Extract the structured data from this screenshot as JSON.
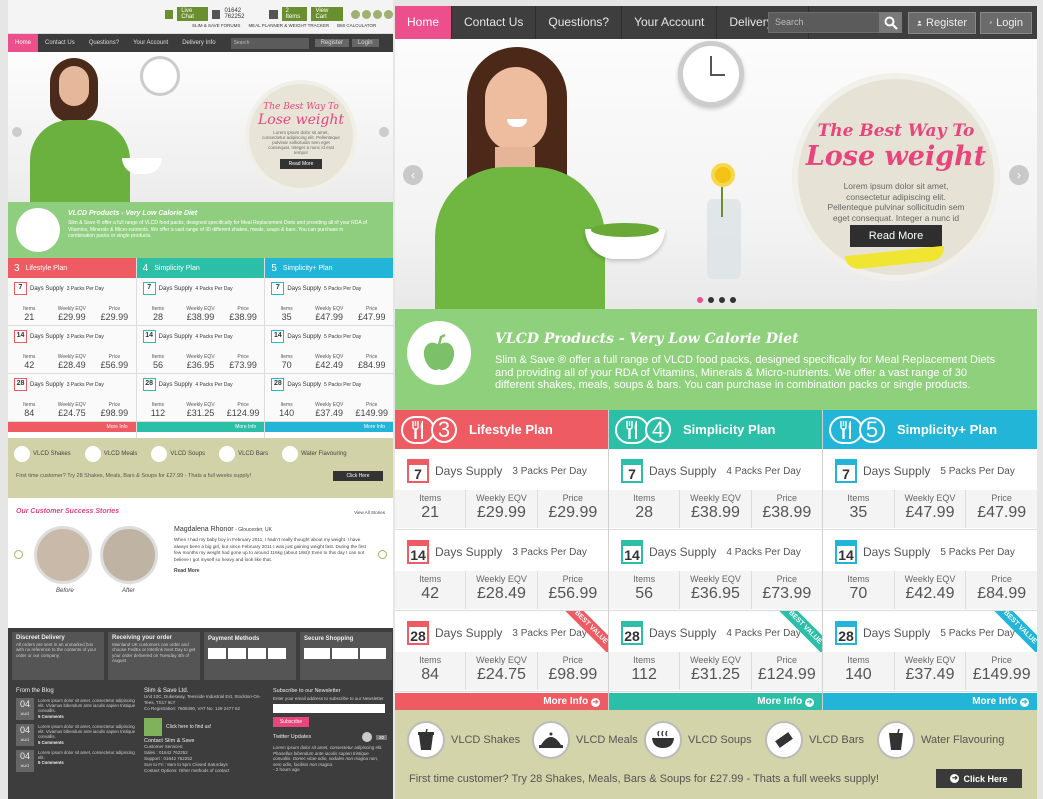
{
  "top_bar": {
    "live_chat": "Live Chat",
    "phone": "01642 762252",
    "items_count": "2 Items",
    "view_cart": "View Cart",
    "links": [
      "SLIM & SAVE FORUMS",
      "MEAL PLANNER & WEIGHT TRACKER",
      "BMI CALCULATOR"
    ]
  },
  "nav": {
    "items": [
      "Home",
      "Contact Us",
      "Questions?",
      "Your Account",
      "Delivery Info"
    ],
    "search_placeholder": "Search",
    "register": "Register",
    "login": "Login"
  },
  "hero": {
    "line1": "The Best Way To",
    "line2": "Lose weight",
    "body": "Lorem ipsum dolor sit amet, consectetur adipiscing elit. Pellenteque pulvinar sollicitudin sem eget consequat. Integer a nunc id erat tempor",
    "cta": "Read More"
  },
  "vlcd": {
    "title": "VLCD Products - Very Low Calorie Diet",
    "body": "Slim & Save ® offer a full range of VLCD food packs, designed specifically for Meal Replacement Diets and providing all of your RDA of Vitamins, Minerals & Micro-nutrients. We offer a vast range of 30 different shakes, meals, soups & bars. You can purchase in combination packs or single products."
  },
  "plans": [
    {
      "num": "3",
      "name": "Lifestyle Plan",
      "color": "#ef5b62",
      "rows": [
        {
          "days": "7",
          "label": "Days Supply",
          "packs": "3 Packs Per Day",
          "items": "21",
          "weekly": "£29.99",
          "price": "£29.99"
        },
        {
          "days": "14",
          "label": "Days Supply",
          "packs": "3 Packs Per Day",
          "items": "42",
          "weekly": "£28.49",
          "price": "£56.99"
        },
        {
          "days": "28",
          "label": "Days Supply",
          "packs": "3 Packs Per Day",
          "items": "84",
          "weekly": "£24.75",
          "price": "£98.99",
          "best": "BEST VALUE"
        }
      ],
      "more": "More Info"
    },
    {
      "num": "4",
      "name": "Simplicity Plan",
      "color": "#2cbfa8",
      "rows": [
        {
          "days": "7",
          "label": "Days Supply",
          "packs": "4 Packs Per Day",
          "items": "28",
          "weekly": "£38.99",
          "price": "£38.99"
        },
        {
          "days": "14",
          "label": "Days Supply",
          "packs": "4 Packs Per Day",
          "items": "56",
          "weekly": "£36.95",
          "price": "£73.99"
        },
        {
          "days": "28",
          "label": "Days Supply",
          "packs": "4 Packs Per Day",
          "items": "112",
          "weekly": "£31.25",
          "price": "£124.99",
          "best": "BEST VALUE"
        }
      ],
      "more": "More Info"
    },
    {
      "num": "5",
      "name": "Simplicity+ Plan",
      "color": "#22b5d7",
      "rows": [
        {
          "days": "7",
          "label": "Days Supply",
          "packs": "5 Packs Per Day",
          "items": "35",
          "weekly": "£47.99",
          "price": "£47.99"
        },
        {
          "days": "14",
          "label": "Days Supply",
          "packs": "5 Packs Per Day",
          "items": "70",
          "weekly": "£42.49",
          "price": "£84.99"
        },
        {
          "days": "28",
          "label": "Days Supply",
          "packs": "5 Packs Per Day",
          "items": "140",
          "weekly": "£37.49",
          "price": "£149.99",
          "best": "BEST VALUE"
        }
      ],
      "more": "More Info"
    }
  ],
  "col_labels": {
    "items": "Items",
    "weekly": "Weekly EQV",
    "price": "Price"
  },
  "categories": [
    "VLCD Shakes",
    "VLCD Meals",
    "VLCD Soups",
    "VLCD Bars",
    "Water Flavouring"
  ],
  "promo": {
    "text": "First time customer? Try 28 Shakes, Meals, Bars & Soups for £27.99  - Thats a full weeks supply!",
    "cta": "Click Here"
  },
  "stories": {
    "title": "Our Customer Success Stories",
    "view_all": "View All Stories",
    "name": "Magdalena Rhonor",
    "location": "- Gloucester, UK",
    "body": "When I had my baby boy in February 2011, I hadn't really thought about my weight. I have always been a big girl, but since February 2011 I was just gaining weight fast. During the first few months my weight had gone up to around 116kg (about 18st)! Even to this day I can not believe I got myself so heavy and look like that.",
    "read_more": "Read More",
    "before": "Before",
    "after": "After"
  },
  "footer": {
    "boxes": [
      {
        "title": "Discreet Delivery",
        "text": "All orders are sent in an unmarked box with no reference to the contents of your order or our company."
      },
      {
        "title": "Receiving your order",
        "text": "Mainland UK customers can order and choose FedEx or Interlink Next Day to get your order delivered on Tuesday 4th of August"
      },
      {
        "title": "Payment Methods"
      },
      {
        "title": "Secure Shopping"
      }
    ],
    "blog_title": "From the Blog",
    "blog": [
      {
        "day": "04",
        "mon": "AUG",
        "text": "Lorem ipsum dolor sit amet, consectetur adipiscing elit. Vivamus bibendum ante iaculis sapien tristique convallis.",
        "comments": "5 Comments"
      },
      {
        "day": "04",
        "mon": "AUG",
        "text": "Lorem ipsum dolor sit amet, consectetur adipiscing elit. Vivamus bibendum ante iaculis sapien tristique convallis.",
        "comments": "5 Comments"
      },
      {
        "day": "04",
        "mon": "AUG",
        "text": "Lorem ipsum dolor sit amet, consectetur adipiscing elit.",
        "comments": "5 Comments"
      }
    ],
    "company": "Slim & Save Ltd.",
    "address": "Unit 10C, Dukesway, Teesside Industrial Est, Stockton-On-Tees, TS17 9LT",
    "registration": "Co Registration: 7608490, VAT No. 129 2477 62",
    "map_link": "Click here to find us!",
    "contact_title": "Contact Slim & Save",
    "contact_lines": [
      "Customer Services:",
      "Sales : 01642 762252",
      "Support : 01642 762252",
      "Sun to Fri : 8am to 5pm Closed Saturdays"
    ],
    "contact_options": "Contact Options: Other methods of contact",
    "newsletter_title": "Subscribe to our Newsletter",
    "newsletter_hint": "Enter your email address to subscribe to our Newsletter",
    "subscribe": "Subscribe",
    "twitter_title": "Twitter Updates",
    "twitter_count": "20",
    "tweet": "Lorem ipsum dolor sit amet, consectetur adipiscing elit. Phasellus bibendum ante iaculis sapien tristique convallis. Donec vitae odio, sodales non magna non, sem odio, facilisis non magna.",
    "tweet_time": "- 2 hours ago"
  }
}
